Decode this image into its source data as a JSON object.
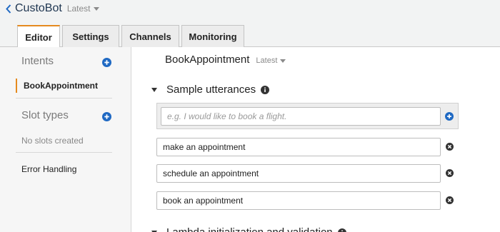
{
  "header": {
    "bot_name": "CustoBot",
    "version_label": "Latest",
    "back_icon": "chevron-left-icon",
    "version_caret_icon": "caret-down-icon"
  },
  "tabs": [
    {
      "label": "Editor",
      "active": true
    },
    {
      "label": "Settings",
      "active": false
    },
    {
      "label": "Channels",
      "active": false
    },
    {
      "label": "Monitoring",
      "active": false
    }
  ],
  "sidebar": {
    "intents_heading": "Intents",
    "intents": [
      {
        "label": "BookAppointment",
        "selected": true
      }
    ],
    "slot_types_heading": "Slot types",
    "slot_types_empty": "No slots created",
    "error_handling_label": "Error Handling",
    "add_icon": "plus-circle-icon"
  },
  "main": {
    "intent_title": "BookAppointment",
    "intent_version": "Latest",
    "sample_utterances": {
      "title": "Sample utterances",
      "new_placeholder": "e.g. I would like to book a flight.",
      "new_value": "",
      "items": [
        "make an appointment",
        "schedule an appointment",
        "book an appointment"
      ]
    },
    "next_section_title": "Lambda initialization and validation"
  },
  "colors": {
    "accent": "#e58a1f",
    "link_blue": "#1f69c3",
    "header_bg": "#f2f3f3",
    "sidebar_bg": "#f6f6f6"
  }
}
